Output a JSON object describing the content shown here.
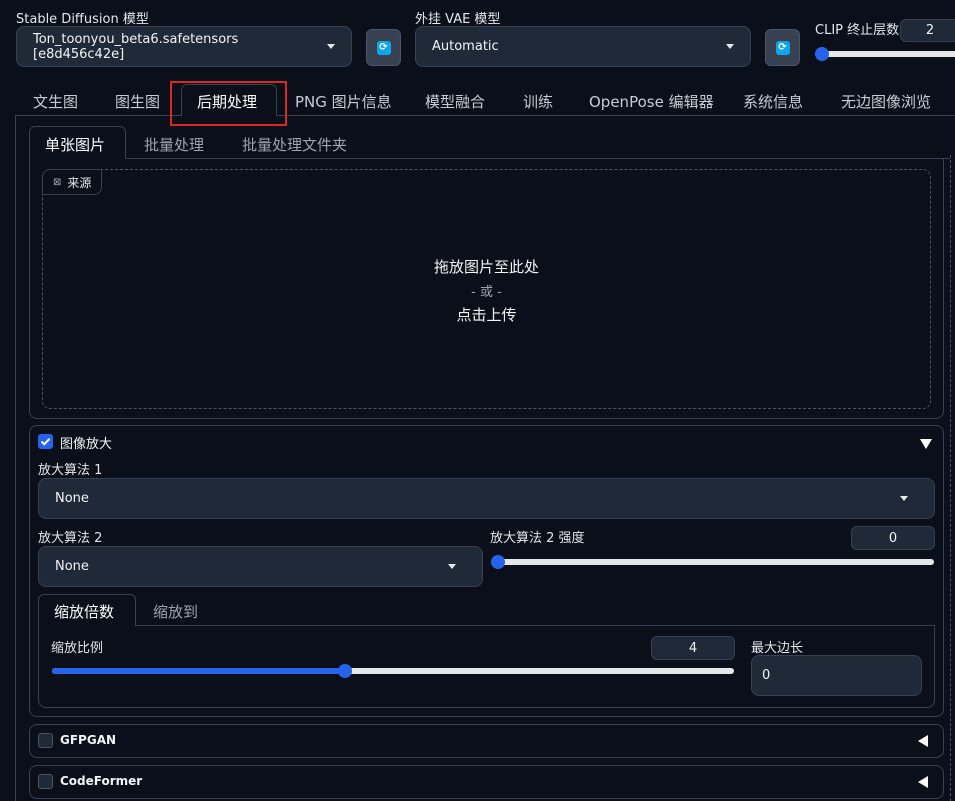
{
  "header": {
    "sd_model_label": "Stable Diffusion 模型",
    "sd_model_value": "Ton_toonyou_beta6.safetensors [e8d456c42e]",
    "vae_label": "外挂 VAE 模型",
    "vae_value": "Automatic",
    "clip_label": "CLIP 终止层数",
    "clip_value": "2",
    "clip_level": 0.0
  },
  "main_tabs": [
    "文生图",
    "图生图",
    "后期处理",
    "PNG 图片信息",
    "模型融合",
    "训练",
    "OpenPose 编辑器",
    "系统信息",
    "无边图像浏览"
  ],
  "active_main_tab": "后期处理",
  "sub_tabs": [
    "单张图片",
    "批量处理",
    "批量处理文件夹"
  ],
  "upload": {
    "source_label": "来源",
    "drop_text": "拖放图片至此处",
    "or_text": "- 或 -",
    "click_text": "点击上传"
  },
  "upscale": {
    "title": "图像放大",
    "upscaler1_label": "放大算法 1",
    "upscaler1_value": "None",
    "upscaler2_label": "放大算法 2",
    "upscaler2_value": "None",
    "upscaler2_strength_label": "放大算法 2 强度",
    "upscaler2_strength_value": "0",
    "upscaler2_strength_level": 0.0,
    "resize_tabs": [
      "缩放倍数",
      "缩放到"
    ],
    "scale_label": "缩放比例",
    "scale_value": "4",
    "scale_level": 0.43,
    "max_side_label": "最大边长",
    "max_side_value": "0"
  },
  "gfpgan_label": "GFPGAN",
  "codeformer_label": "CodeFormer",
  "colors": {
    "accent": "#2563eb",
    "background": "#0b0f19",
    "highlight_box": "#dc2626"
  }
}
